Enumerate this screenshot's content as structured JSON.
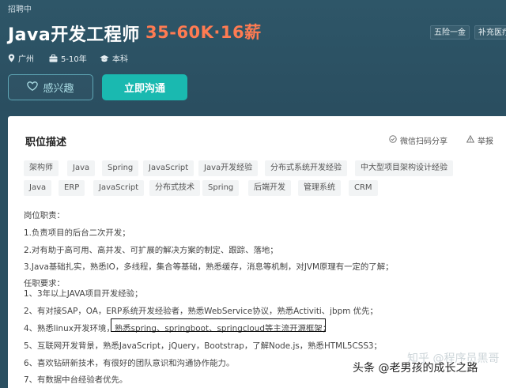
{
  "header": {
    "status": "招聘中",
    "title": "Java开发工程师",
    "salary": "35-60K·16薪",
    "benefits": [
      "五险一金",
      "补充医疗"
    ],
    "location": "广州",
    "experience": "5-10年",
    "education": "本科"
  },
  "actions": {
    "interest_label": "感兴趣",
    "chat_label": "立即沟通"
  },
  "card": {
    "section_title": "职位描述",
    "share_label": "微信扫码分享",
    "report_label": "举报",
    "tags_row1": [
      "架构师",
      "Java",
      "Spring",
      "JavaScript",
      "Java开发经验",
      "分布式系统开发经验",
      "中大型项目架构设计经验"
    ],
    "tags_row2": [
      "Java",
      "ERP",
      "JavaScript",
      "分布式技术",
      "Spring",
      "后端开发",
      "管理系统",
      "CRM"
    ],
    "lines": [
      "岗位职责：",
      "1.负责项目的后台二次开发；",
      "2.对有助于高可用、高并发、可扩展的解决方案的制定、跟踪、落地；",
      "3.Java基础扎实，熟悉IO，多线程，集合等基础，熟悉缓存，消息等机制，对JVM原理有一定的了解；",
      "任职要求：",
      "1、3年以上JAVA项目开发经验；",
      "2、有对接SAP，OA，ERP系统开发经验者，熟悉WebService协议，熟悉Activiti、jbpm 优先；",
      "4、熟悉linux开发环境，熟悉spring、springboot、springcloud等主流开源框架；",
      "5、互联网开发背景，熟悉JavaScript，jQuery，Bootstrap，了解Node.js，熟悉HTML5CSS3；",
      "6、喜欢钻研新技术，有很好的团队意识和沟通协作能力。",
      "7、有数据中台经验者优先。"
    ]
  },
  "watermark": {
    "text": "头条 @老男孩的成长之路",
    "faded": "知乎 @程序员黑哥"
  },
  "colors": {
    "header_bg": "#2a4f61",
    "salary": "#ff7b52",
    "chat_button": "#1ab9b0",
    "interest_border": "#5fa6b5"
  }
}
